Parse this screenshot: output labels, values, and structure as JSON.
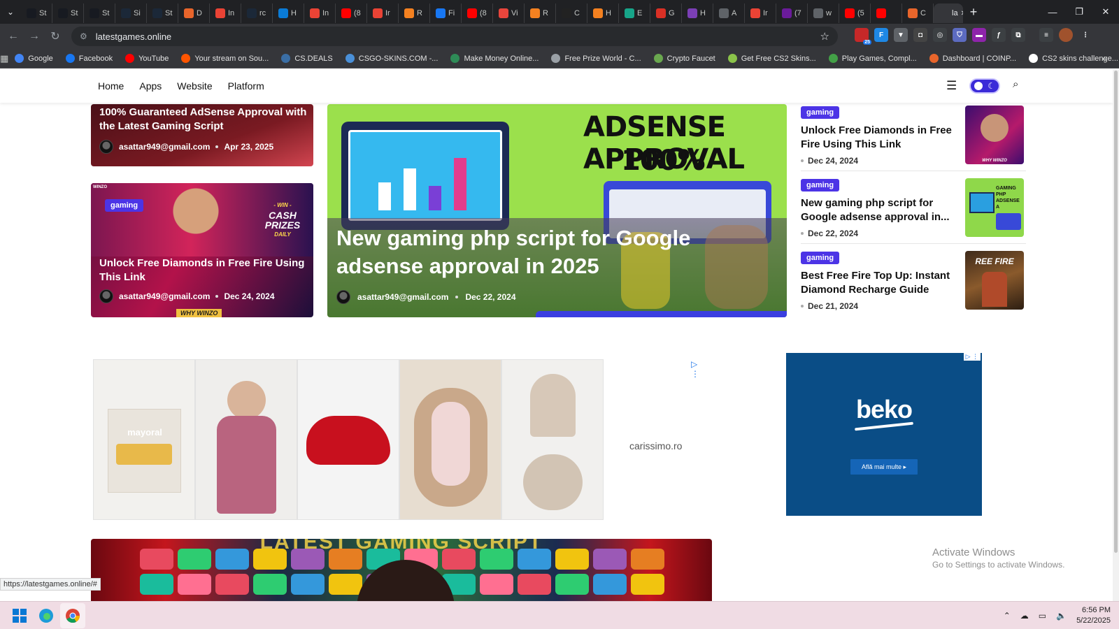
{
  "browser": {
    "tabs": [
      {
        "label": "St",
        "color": "#171a21",
        "icon": "steam-icon"
      },
      {
        "label": "St",
        "color": "#171a21",
        "icon": "steam-icon"
      },
      {
        "label": "St",
        "color": "#171a21",
        "icon": "steam-icon"
      },
      {
        "label": "Si",
        "color": "#1b2838",
        "icon": "steam-icon"
      },
      {
        "label": "St",
        "color": "#1b2838",
        "icon": "steam-icon"
      },
      {
        "label": "D",
        "color": "#e8652b",
        "icon": "cat-icon"
      },
      {
        "label": "In",
        "color": "#ea4335",
        "icon": "gmail-icon"
      },
      {
        "label": "rc",
        "color": "#1b2838",
        "icon": "steam-icon"
      },
      {
        "label": "H",
        "color": "#0a7bd6",
        "icon": "zte-icon"
      },
      {
        "label": "In",
        "color": "#ea4335",
        "icon": "gmail-icon"
      },
      {
        "label": "(8",
        "color": "#ff0000",
        "icon": "youtube-icon"
      },
      {
        "label": "Ir",
        "color": "#ea4335",
        "icon": "gmail-icon"
      },
      {
        "label": "R",
        "color": "#f48120",
        "icon": "feed-icon"
      },
      {
        "label": "Fi",
        "color": "#1877f2",
        "icon": "facebook-icon"
      },
      {
        "label": "(8",
        "color": "#ff0000",
        "icon": "youtube-icon"
      },
      {
        "label": "Vi",
        "color": "#e8453c",
        "icon": "v-icon"
      },
      {
        "label": "R",
        "color": "#f48120",
        "icon": "feed-icon"
      },
      {
        "label": "C",
        "color": "#222222",
        "icon": "circle-icon"
      },
      {
        "label": "H",
        "color": "#f48120",
        "icon": "feed-icon"
      },
      {
        "label": "E",
        "color": "#17a589",
        "icon": "diamond-icon"
      },
      {
        "label": "G",
        "color": "#d93025",
        "icon": "image-icon"
      },
      {
        "label": "H",
        "color": "#7b3fb5",
        "icon": "puzzle-icon"
      },
      {
        "label": "A",
        "color": "#5f6368",
        "icon": "globe-icon"
      },
      {
        "label": "Ir",
        "color": "#ea4335",
        "icon": "gmail-icon"
      },
      {
        "label": "(7",
        "color": "#6a1b9a",
        "icon": "mail-icon"
      },
      {
        "label": "w",
        "color": "#5f6368",
        "icon": "globe-icon"
      },
      {
        "label": "(5",
        "color": "#ff0000",
        "icon": "youtube-icon"
      },
      {
        "label": "",
        "color": "#ff0000",
        "icon": "youtube-audio-icon"
      },
      {
        "label": "C",
        "color": "#e8652b",
        "icon": "cat-icon"
      },
      {
        "label": "la",
        "color": "#35363a",
        "icon": "page-icon",
        "active": true
      }
    ],
    "url": "latestgames.online",
    "extension_badge": "25",
    "bookmarks": [
      {
        "label": "Google",
        "color": "#4285f4"
      },
      {
        "label": "Facebook",
        "color": "#1877f2"
      },
      {
        "label": "YouTube",
        "color": "#ff0000"
      },
      {
        "label": "Your stream on Sou...",
        "color": "#ff5500"
      },
      {
        "label": "CS.DEALS",
        "color": "#3a6ea5"
      },
      {
        "label": "CSGO-SKINS.COM -...",
        "color": "#4a90d9"
      },
      {
        "label": "Make Money Online...",
        "color": "#2e8b57"
      },
      {
        "label": "Free Prize World - C...",
        "color": "#9aa0a6"
      },
      {
        "label": "Crypto Faucet",
        "color": "#6aa84f"
      },
      {
        "label": "Get Free CS2 Skins...",
        "color": "#8bc34a"
      },
      {
        "label": "Play Games, Compl...",
        "color": "#43a047"
      },
      {
        "label": "Dashboard | COINP...",
        "color": "#e8652b"
      },
      {
        "label": "CS2 skins challenge...",
        "color": "#ffffff"
      }
    ]
  },
  "site": {
    "nav": [
      "Home",
      "Apps",
      "Website",
      "Platform"
    ],
    "featured_left": [
      {
        "title": "100% Guaranteed AdSense Approval with the Latest Gaming Script",
        "author": "asattar949@gmail.com",
        "date": "Apr 23, 2025"
      },
      {
        "tag": "gaming",
        "title": "Unlock Free Diamonds in Free Fire Using This Link",
        "author": "asattar949@gmail.com",
        "date": "Dec 24, 2024",
        "art_text": {
          "brand": "WINZO",
          "prize_top": "- WIN -",
          "prize_main": "CASH PRIZES",
          "prize_sub": "DAILY",
          "footer": "WHY WINZO"
        }
      }
    ],
    "hero": {
      "image_text_1": "ADSENSE APPROVAL",
      "image_text_2": "100% WORKING",
      "title": "New gaming php script for Google adsense approval in 2025",
      "author": "asattar949@gmail.com",
      "date": "Dec 22, 2024"
    },
    "side_list": [
      {
        "tag": "gaming",
        "title": "Unlock Free Diamonds in Free Fire Using This Link",
        "date": "Dec 24, 2024",
        "thumb_text": "WHY WINZO"
      },
      {
        "tag": "gaming",
        "title": "New gaming php script for Google adsense approval in...",
        "date": "Dec 22, 2024",
        "thumb_text": "GAMING PHP ADSENSE A"
      },
      {
        "tag": "gaming",
        "title": "Best Free Fire Top Up: Instant Diamond Recharge Guide",
        "date": "Dec 21, 2024",
        "thumb_text": "REE FIRE"
      }
    ],
    "ads": {
      "ad1_brand": "carissimo.ro",
      "ad1_tile_text": "mayoral",
      "ad2_brand": "beko",
      "ad2_cta": "Află mai multe  ▸"
    },
    "banner_text": "LATEST GAMING SCRIPT"
  },
  "overlay": {
    "watermark_title": "Activate Windows",
    "watermark_sub": "Go to Settings to activate Windows.",
    "status_url": "https://latestgames.online/#"
  },
  "taskbar": {
    "time": "6:56 PM",
    "date": "5/22/2025"
  },
  "colors": {
    "tag_bg": "#4c34e6",
    "toggle_bg": "#3a2ad8",
    "hero_bg": "#9be04c",
    "ad2_bg": "#0a4d86"
  }
}
